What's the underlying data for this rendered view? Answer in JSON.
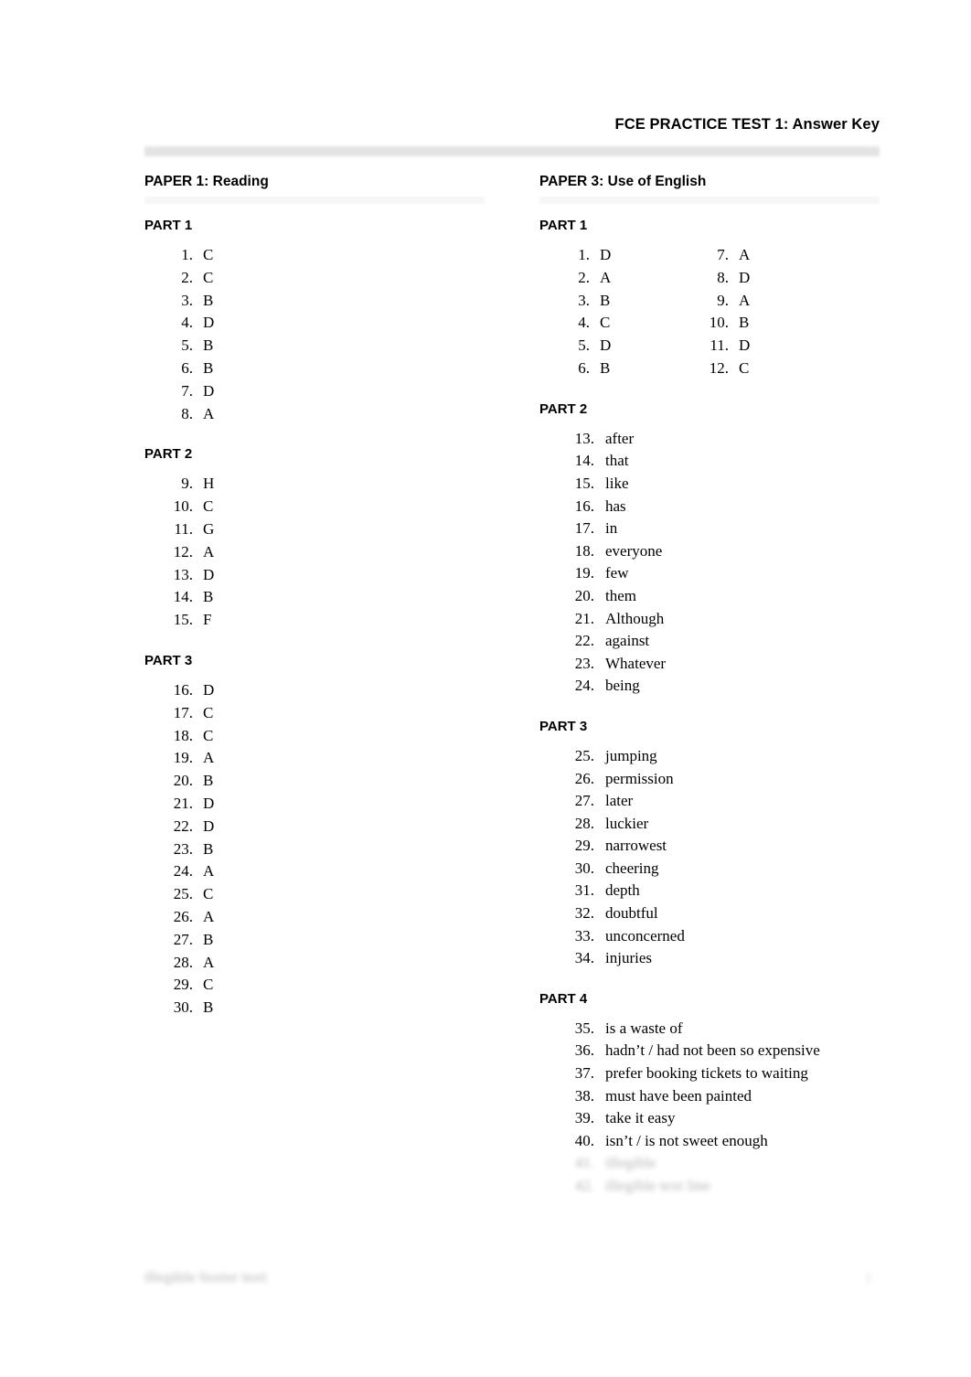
{
  "document": {
    "title": "FCE PRACTICE TEST 1: Answer Key"
  },
  "columns": {
    "left": {
      "paper_heading": "PAPER 1: Reading",
      "parts": [
        {
          "heading": "PART 1",
          "items": [
            {
              "num": "1.",
              "answer": "C"
            },
            {
              "num": "2.",
              "answer": "C"
            },
            {
              "num": "3.",
              "answer": "B"
            },
            {
              "num": "4.",
              "answer": "D"
            },
            {
              "num": "5.",
              "answer": "B"
            },
            {
              "num": "6.",
              "answer": "B"
            },
            {
              "num": "7.",
              "answer": "D"
            },
            {
              "num": "8.",
              "answer": "A"
            }
          ]
        },
        {
          "heading": "PART 2",
          "items": [
            {
              "num": "9.",
              "answer": "H"
            },
            {
              "num": "10.",
              "answer": "C"
            },
            {
              "num": "11.",
              "answer": "G"
            },
            {
              "num": "12.",
              "answer": "A"
            },
            {
              "num": "13.",
              "answer": "D"
            },
            {
              "num": "14.",
              "answer": "B"
            },
            {
              "num": "15.",
              "answer": "F"
            }
          ]
        },
        {
          "heading": "PART 3",
          "items": [
            {
              "num": "16.",
              "answer": "D"
            },
            {
              "num": "17.",
              "answer": "C"
            },
            {
              "num": "18.",
              "answer": "C"
            },
            {
              "num": "19.",
              "answer": "A"
            },
            {
              "num": "20.",
              "answer": "B"
            },
            {
              "num": "21.",
              "answer": "D"
            },
            {
              "num": "22.",
              "answer": "D"
            },
            {
              "num": "23.",
              "answer": "B"
            },
            {
              "num": "24.",
              "answer": "A"
            },
            {
              "num": "25.",
              "answer": "C"
            },
            {
              "num": "26.",
              "answer": "A"
            },
            {
              "num": "27.",
              "answer": "B"
            },
            {
              "num": "28.",
              "answer": "A"
            },
            {
              "num": "29.",
              "answer": "C"
            },
            {
              "num": "30.",
              "answer": "B"
            }
          ]
        }
      ]
    },
    "right": {
      "paper_heading": "PAPER 3: Use of English",
      "part1": {
        "heading": "PART 1",
        "items_a": [
          {
            "num": "1.",
            "answer": "D"
          },
          {
            "num": "2.",
            "answer": "A"
          },
          {
            "num": "3.",
            "answer": "B"
          },
          {
            "num": "4.",
            "answer": "C"
          },
          {
            "num": "5.",
            "answer": "D"
          },
          {
            "num": "6.",
            "answer": "B"
          }
        ],
        "items_b": [
          {
            "num": "7.",
            "answer": "A"
          },
          {
            "num": "8.",
            "answer": "D"
          },
          {
            "num": "9.",
            "answer": "A"
          },
          {
            "num": "10.",
            "answer": "B"
          },
          {
            "num": "11.",
            "answer": "D"
          },
          {
            "num": "12.",
            "answer": "C"
          }
        ]
      },
      "part2": {
        "heading": "PART 2",
        "items": [
          {
            "num": "13.",
            "answer": "after"
          },
          {
            "num": "14.",
            "answer": "that"
          },
          {
            "num": "15.",
            "answer": "like"
          },
          {
            "num": "16.",
            "answer": "has"
          },
          {
            "num": "17.",
            "answer": "in"
          },
          {
            "num": "18.",
            "answer": "everyone"
          },
          {
            "num": "19.",
            "answer": "few"
          },
          {
            "num": "20.",
            "answer": "them"
          },
          {
            "num": "21.",
            "answer": "Although"
          },
          {
            "num": "22.",
            "answer": "against"
          },
          {
            "num": "23.",
            "answer": "Whatever"
          },
          {
            "num": "24.",
            "answer": "being"
          }
        ]
      },
      "part3": {
        "heading": "PART 3",
        "items": [
          {
            "num": "25.",
            "answer": "jumping"
          },
          {
            "num": "26.",
            "answer": "permission"
          },
          {
            "num": "27.",
            "answer": "later"
          },
          {
            "num": "28.",
            "answer": "luckier"
          },
          {
            "num": "29.",
            "answer": "narrowest"
          },
          {
            "num": "30.",
            "answer": "cheering"
          },
          {
            "num": "31.",
            "answer": "depth"
          },
          {
            "num": "32.",
            "answer": "doubtful"
          },
          {
            "num": "33.",
            "answer": "unconcerned"
          },
          {
            "num": "34.",
            "answer": "injuries"
          }
        ]
      },
      "part4": {
        "heading": "PART 4",
        "items": [
          {
            "num": "35.",
            "answer": "is a waste of"
          },
          {
            "num": "36.",
            "answer": "hadn’t / had not been so expensive"
          },
          {
            "num": "37.",
            "answer": "prefer booking tickets to waiting"
          },
          {
            "num": "38.",
            "answer": "must have been painted"
          },
          {
            "num": "39.",
            "answer": "take it easy"
          },
          {
            "num": "40.",
            "answer": "isn’t / is not sweet enough"
          }
        ],
        "obscured_items": [
          {
            "num": "41.",
            "answer": "illegible"
          },
          {
            "num": "42.",
            "answer": "illegible text line"
          }
        ]
      }
    }
  },
  "footer": {
    "text": "illegible footer text",
    "page_number": "1"
  }
}
